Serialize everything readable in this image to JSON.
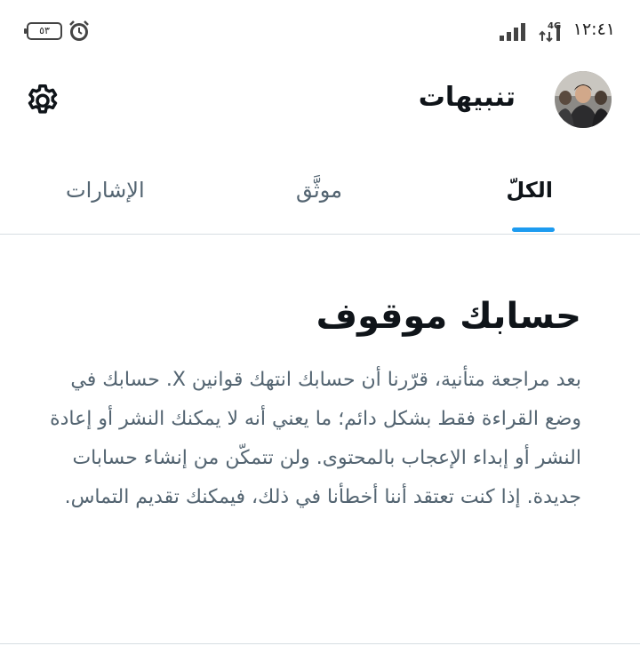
{
  "status_bar": {
    "time": "١٢:٤١",
    "battery": "٥٣",
    "network": "4G"
  },
  "header": {
    "title": "تنبيهات"
  },
  "tabs": [
    {
      "label": "الكلّ",
      "active": true
    },
    {
      "label": "موثَّق",
      "active": false
    },
    {
      "label": "الإشارات",
      "active": false
    }
  ],
  "notice": {
    "title": "حسابك موقوف",
    "body": "بعد مراجعة متأنية، قرّرنا أن حسابك انتهك قوانين X. حسابك في وضع القراءة فقط بشكل دائم؛ ما يعني أنه لا يمكنك النشر أو إعادة النشر أو إبداء الإعجاب بالمحتوى. ولن تتمكّن من إنشاء حسابات جديدة. إذا كنت تعتقد أننا أخطأنا في ذلك، فيمكنك تقديم التماس."
  },
  "colors": {
    "accent": "#1d9bf0",
    "text_primary": "#0f1419",
    "text_secondary": "#536471"
  },
  "icons": {
    "settings": "gear-icon",
    "alarm": "alarm-clock-icon",
    "signal": "signal-bars-icon"
  }
}
